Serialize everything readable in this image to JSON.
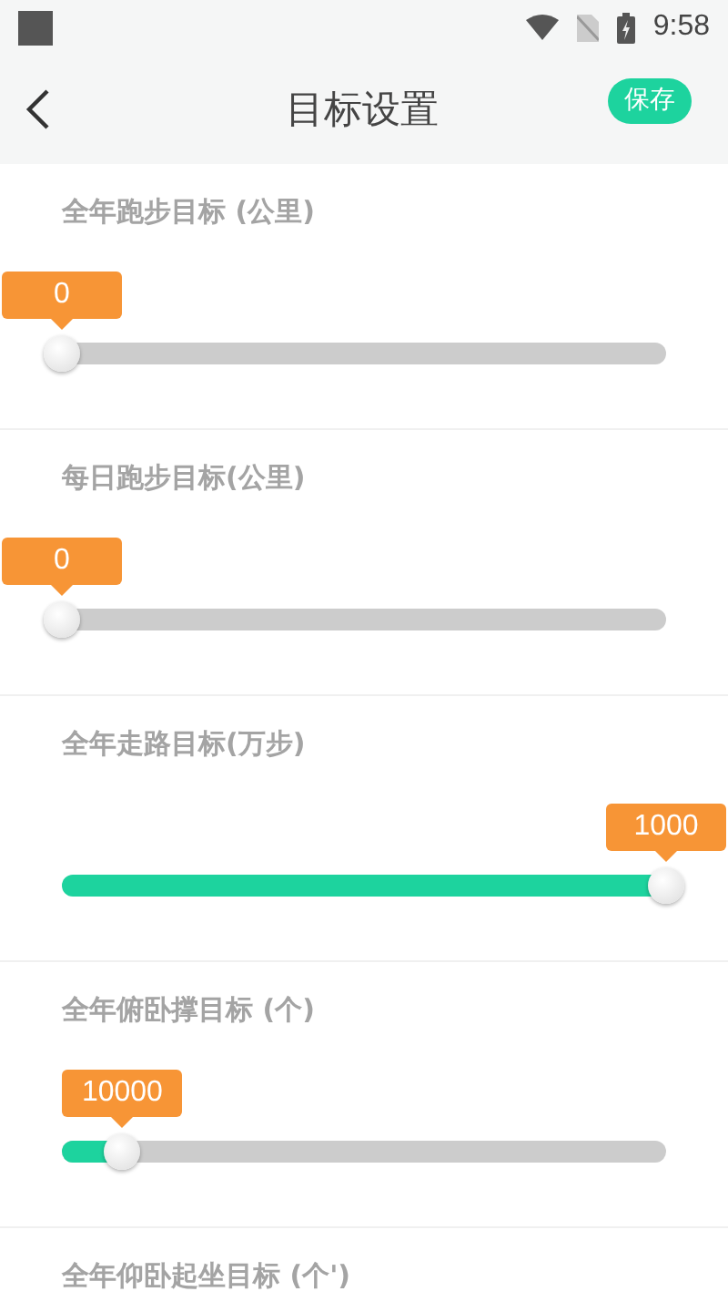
{
  "status_bar": {
    "time": "9:58"
  },
  "app_bar": {
    "title": "目标设置",
    "save_button": "保存"
  },
  "goals": [
    {
      "label": "全年跑步目标 (公里)",
      "value": "0",
      "level": 0
    },
    {
      "label": "每日跑步目标(公里)",
      "value": "0",
      "level": 0
    },
    {
      "label": "全年走路目标(万步)",
      "value": "1000",
      "level": 1
    },
    {
      "label": "全年俯卧撑目标 (个)",
      "value": "10000",
      "level": 0.1
    },
    {
      "label": "全年仰卧起坐目标 (个')"
    }
  ]
}
